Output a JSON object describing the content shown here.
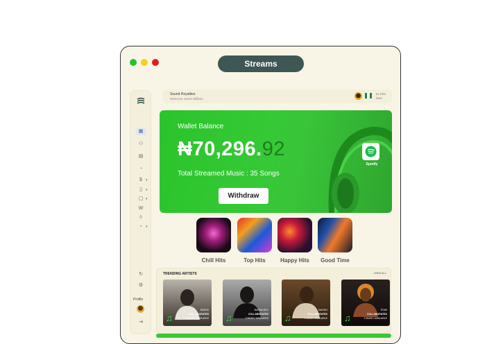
{
  "window": {
    "title": "Streams"
  },
  "header": {
    "title": "Sound Royalties",
    "subtitle": "Welcome Jamie William",
    "lang_top": "EL PER",
    "lang_bottom": "ENG"
  },
  "wallet": {
    "label": "Wallet Balance",
    "amount_main": "₦70,296.",
    "amount_cents": "92",
    "total": "Total Streamed Music : 35 Songs",
    "button": "Withdraw",
    "spotify_label": "Spotify"
  },
  "sidebar": {
    "profile_label": "Profile"
  },
  "playlists": [
    {
      "label": "Chill Hits"
    },
    {
      "label": "Top Hits"
    },
    {
      "label": "Happy Hits"
    },
    {
      "label": "Good Time"
    }
  ],
  "trending": {
    "title": "TRENDING ARTISTS",
    "view_all": "VIEW ALL",
    "artists": [
      {
        "name": "WIZKID",
        "collab": "COLLABORATED",
        "avail": "9 MUSIC AVAILABLE"
      },
      {
        "name": "BURNA BOY",
        "collab": "COLLABORATED",
        "avail": "9 MUSIC AVAILABLE"
      },
      {
        "name": "DAVIDO",
        "collab": "COLLABORATED",
        "avail": "9 MUSIC AVAILABLE"
      },
      {
        "name": "TEMS",
        "collab": "COLLABORATED",
        "avail": "9 MUSIC AVAILABLE"
      }
    ]
  },
  "colors": {
    "accent": "#35c935",
    "title_pill": "#3e5654",
    "window_bg": "#f8f5e6"
  }
}
